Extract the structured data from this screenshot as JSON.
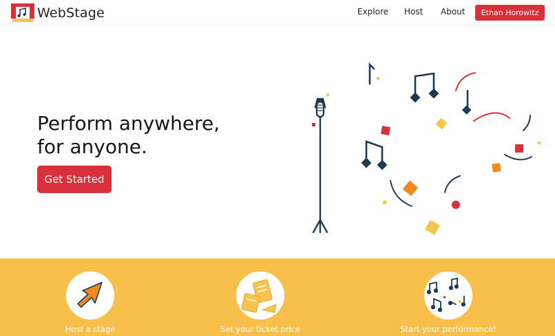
{
  "brand": {
    "name": "WebStage",
    "icon": "music-stage-logo"
  },
  "nav": {
    "explore": "Explore",
    "host": "Host",
    "about": "About",
    "user": "Ethan Horowitz"
  },
  "hero": {
    "title_line1": "Perform anywhere,",
    "title_line2": "for anyone.",
    "cta": "Get Started"
  },
  "features": [
    {
      "label": "Host a stage",
      "icon": "cursor-arrow-icon"
    },
    {
      "label": "Set your ticket price",
      "icon": "tickets-icon"
    },
    {
      "label": "Start your performance!",
      "icon": "music-notes-icon"
    }
  ],
  "colors": {
    "accent": "#d8313b",
    "band": "#f9bf4b",
    "navy": "#1e3a52",
    "orange": "#f08a1c",
    "yellow": "#f6c54f"
  }
}
